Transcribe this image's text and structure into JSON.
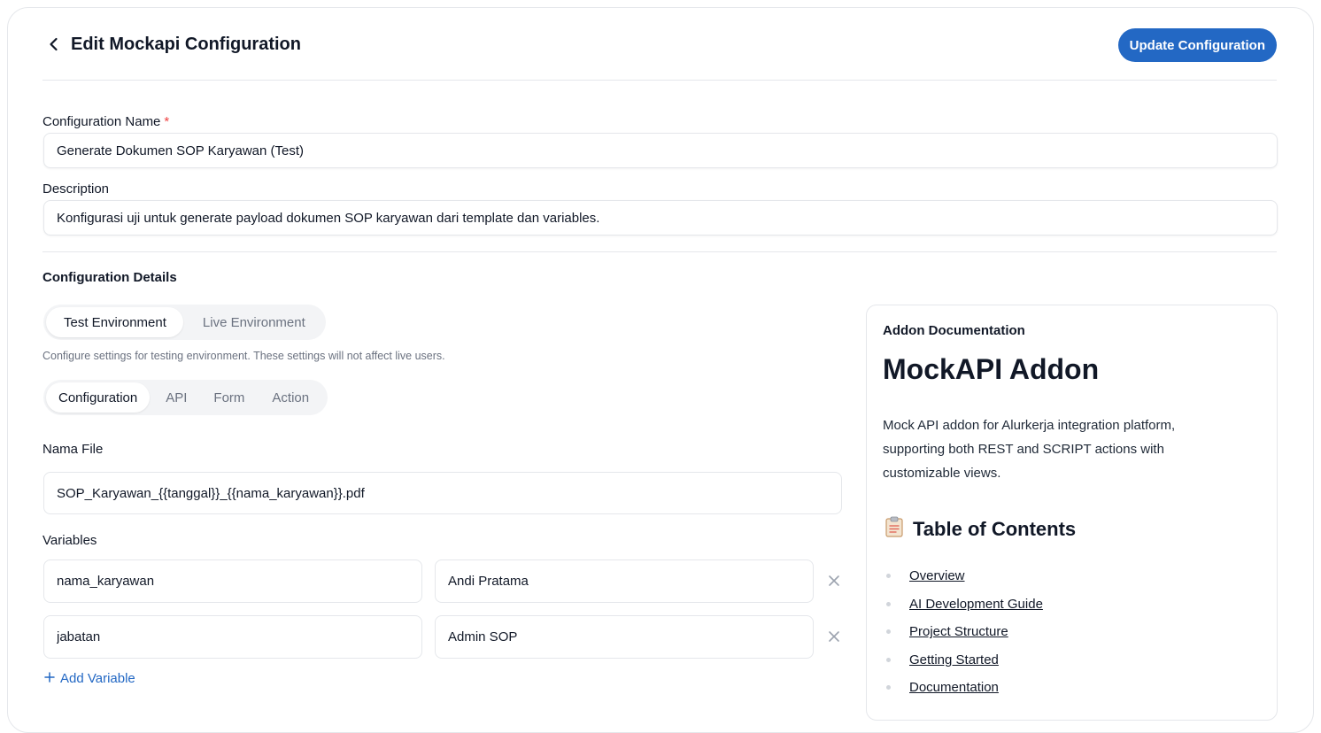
{
  "header": {
    "title": "Edit Mockapi Configuration",
    "back_icon": "chevron-left-icon",
    "update_label": "Update Configuration"
  },
  "form": {
    "name_label": "Configuration Name",
    "required_mark": "*",
    "name_value": "Generate Dokumen SOP Karyawan (Test)",
    "description_label": "Description",
    "description_value": "Konfigurasi uji untuk generate payload dokumen SOP karyawan dari template dan variables."
  },
  "details": {
    "section_title": "Configuration Details",
    "env_tabs": [
      "Test Environment",
      "Live Environment"
    ],
    "env_active": "Test Environment",
    "env_hint": "Configure settings for testing environment. These settings will not affect live users.",
    "sub_tabs": [
      "Configuration",
      "API",
      "Form",
      "Action"
    ],
    "sub_active": "Configuration",
    "file_label": "Nama File",
    "file_value": "SOP_Karyawan_{{tanggal}}_{{nama_karyawan}}.pdf",
    "variables_label": "Variables",
    "variables": [
      {
        "key": "nama_karyawan",
        "value": "Andi Pratama"
      },
      {
        "key": "jabatan",
        "value": "Admin SOP"
      }
    ],
    "add_variable_label": "Add Variable",
    "remove_icon": "close-icon",
    "add_icon": "plus-icon"
  },
  "doc": {
    "eyebrow": "Addon Documentation",
    "title": "MockAPI Addon",
    "description": "Mock API addon for Alurkerja integration platform, supporting both REST and SCRIPT actions with customizable views.",
    "toc_icon": "clipboard-icon",
    "toc_title": "Table of Contents",
    "toc_items": [
      "Overview",
      "AI Development Guide",
      "Project Structure",
      "Getting Started",
      "Documentation"
    ]
  },
  "colors": {
    "primary": "#2368c4",
    "required": "#ef4444",
    "border": "#e5e7eb",
    "segment_bg": "#f3f4f6"
  }
}
